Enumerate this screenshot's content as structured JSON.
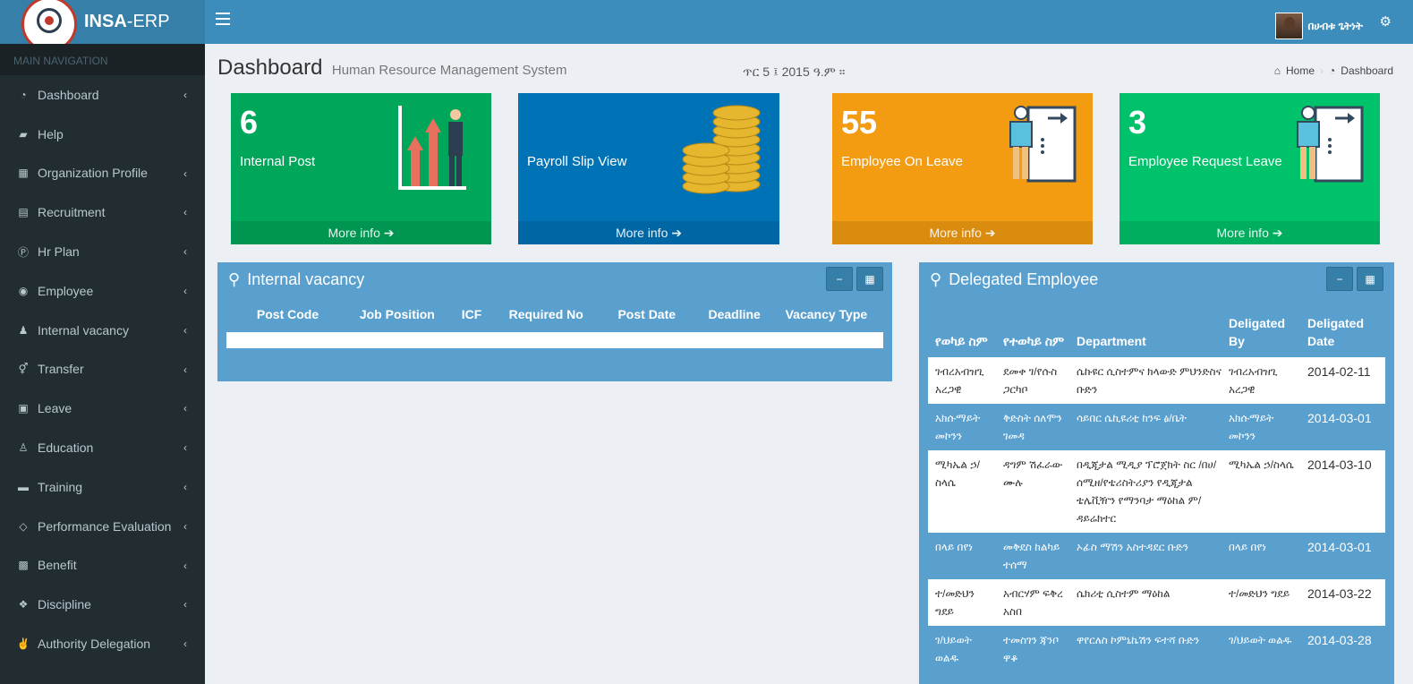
{
  "brand": {
    "bold": "INSA",
    "rest": "-ERP"
  },
  "user": {
    "name": "በሀብቱ ጌትነት"
  },
  "sidebar": {
    "header": "MAIN NAVIGATION",
    "items": [
      {
        "label": "Dashboard",
        "icon": "dashboard-icon",
        "glyph": "◔"
      },
      {
        "label": "Help",
        "icon": "folder-open-icon",
        "glyph": "▰"
      },
      {
        "label": "Organization Profile",
        "icon": "building-icon",
        "glyph": "▦"
      },
      {
        "label": "Recruitment",
        "icon": "id-card-icon",
        "glyph": "▤"
      },
      {
        "label": "Hr Plan",
        "icon": "product-hunt-icon",
        "glyph": "Ⓟ"
      },
      {
        "label": "Employee",
        "icon": "user-circle-icon",
        "glyph": "◉"
      },
      {
        "label": "Internal vacancy",
        "icon": "users-icon",
        "glyph": "♟"
      },
      {
        "label": "Transfer",
        "icon": "transgender-icon",
        "glyph": "⚥"
      },
      {
        "label": "Leave",
        "icon": "cc-icon",
        "glyph": "▣"
      },
      {
        "label": "Education",
        "icon": "graduation-icon",
        "glyph": "♙"
      },
      {
        "label": "Training",
        "icon": "bus-icon",
        "glyph": "▬"
      },
      {
        "label": "Performance Evaluation",
        "icon": "diamond-icon",
        "glyph": "◇"
      },
      {
        "label": "Benefit",
        "icon": "behance-icon",
        "glyph": "▩"
      },
      {
        "label": "Discipline",
        "icon": "dropbox-icon",
        "glyph": "❖"
      },
      {
        "label": "Authority Delegation",
        "icon": "hand-peace-icon",
        "glyph": "✌"
      }
    ],
    "chevron": "‹"
  },
  "header": {
    "title": "Dashboard",
    "subtitle": "Human Resource Management System",
    "date": "ጥር 5 ፤ 2015 ዓ.ም ፡፡",
    "breadcrumb_home": "Home",
    "breadcrumb_current": "Dashboard"
  },
  "boxes": [
    {
      "number": "6",
      "label": "Internal Post",
      "more": "More info",
      "color": "#00a65a"
    },
    {
      "number": "",
      "label": "Payroll Slip View",
      "more": "More info",
      "color": "#0073b7"
    },
    {
      "number": "55",
      "label": "Employee On Leave",
      "more": "More info",
      "color": "#f39c12"
    },
    {
      "number": "3",
      "label": "Employee Request Leave",
      "more": "More info",
      "color": "#00c26a"
    }
  ],
  "vacancy": {
    "title": "Internal vacancy",
    "columns": [
      "Post Code",
      "Job Position",
      "ICF",
      "Required No",
      "Post Date",
      "Deadline",
      "Vacancy Type"
    ]
  },
  "delegated": {
    "title": "Delegated Employee",
    "columns": [
      "የወካይ ስም",
      "የተወካይ ስም",
      "Department",
      "Deligated By",
      "Deligated Date"
    ],
    "rows": [
      [
        "ገብረአብዝጊ አረጋዊ",
        "ደመቀ ገ/የሱስ ጋርካቦ",
        "ሴኩዩር ሲስተምና ክላውድ ምህንድስና ቡድን",
        "ገብረአብዝጊ አረጋዊ",
        "2014-02-11"
      ],
      [
        "አክሱማይት መኮንን",
        "ቅድስት ሰለሞን ገመዳ",
        "ሳይበር ሴኪዩሪቲ ከንፍ ፅ/ቤት",
        "አክሱማይት መኮንን",
        "2014-03-01"
      ],
      [
        "ሚካኤል ኃ/ስላሴ",
        "ዳግም ሽፈራው ሙሉ",
        "በዲጂታል ሚዲያ ፕሮጀክት ስር /በሀ/ሰሚዘ/የቴሪስትሪያን የዲጂታል ቴሌቪዥን የማንባታ ማዕከል ም/ዳይሬክተር",
        "ሚካኤል ኃ/ስላሴ",
        "2014-03-10"
      ],
      [
        "በላይ በየነ",
        "መቅደስ ከልካይ ተሰማ",
        "ኦፊስ ማሽን አስተዳደር ቡድን",
        "በላይ በየነ",
        "2014-03-01"
      ],
      [
        "ተ/መድህን ግደይ",
        "አብርሃም ፍቅረ አስበ",
        "ሴክሪቲ ሲስተም ማዕከል",
        "ተ/መድህን ግደይ",
        "2014-03-22"
      ],
      [
        "ገ/ህይወት ወልዱ",
        "ተመስገን ጃንቦ ዋቆ",
        "ዋየርለስ ኮምኒኬሽን ፍተሻ ቡድን",
        "ገ/ህይወት ወልዱ",
        "2014-03-28"
      ]
    ]
  }
}
